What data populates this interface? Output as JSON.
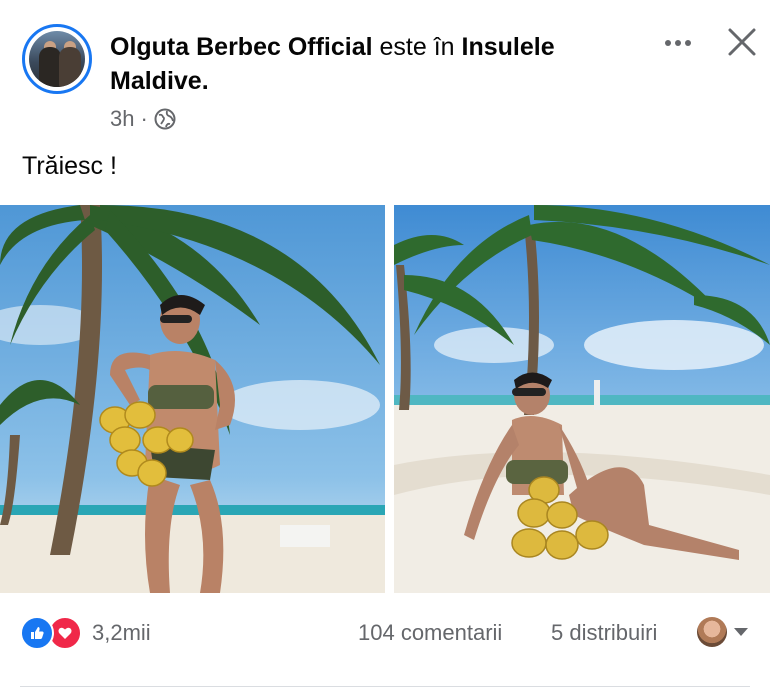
{
  "post": {
    "author": "Olguta Berbec Official",
    "connector": "este în",
    "location": "Insulele Maldive.",
    "time": "3h",
    "separator": "·",
    "caption": "Trăiesc !"
  },
  "icons": {
    "privacy": "globe-icon",
    "menu": "more-icon",
    "close": "close-icon",
    "reaction_1": "like-icon",
    "reaction_2": "love-icon"
  },
  "footer": {
    "reactions_count": "3,2mii",
    "comments": "104 comentarii",
    "shares": "5 distribuiri"
  },
  "colors": {
    "accent": "#1877f2",
    "love": "#f02849",
    "secondary_text": "#65676b"
  }
}
